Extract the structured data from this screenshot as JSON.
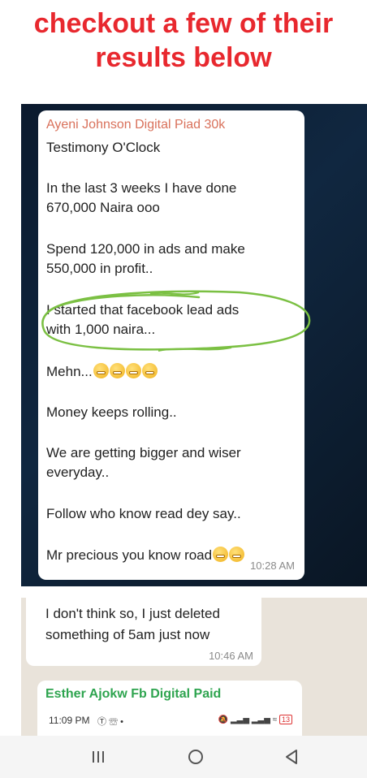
{
  "headline": {
    "line1": "checkout a few of their",
    "line2": "results below"
  },
  "chat1": {
    "sender": "Ayeni Johnson Digital Piad 30k",
    "lines": [
      "Testimony O'Clock",
      "In the last 3 weeks I have done",
      "670,000 Naira  ooo",
      "Spend 120,000 in ads and make",
      "550,000 in profit..",
      "I started that facebook lead ads",
      "with 1,000 naira...",
      "Mehn...",
      "Money keeps rolling..",
      "We are getting bigger and wiser",
      "everyday..",
      "Follow who know read dey say..",
      "Mr precious you know road"
    ],
    "time": "10:28 AM",
    "highlight_color": "#7bc043",
    "sender_color": "#d9715b"
  },
  "chat2": {
    "lines": [
      "I don't think so, I just deleted",
      "something of 5am just now"
    ],
    "time": "10:46 AM"
  },
  "chat3": {
    "sender": "Esther Ajokw Fb Digital Paid",
    "sender_color": "#2ea44f",
    "status_time": "11:09 PM",
    "battery": "13"
  },
  "navbar": {
    "icons": [
      "menu-icon",
      "home-icon",
      "back-icon"
    ]
  },
  "colors": {
    "headline": "#e8282e"
  }
}
